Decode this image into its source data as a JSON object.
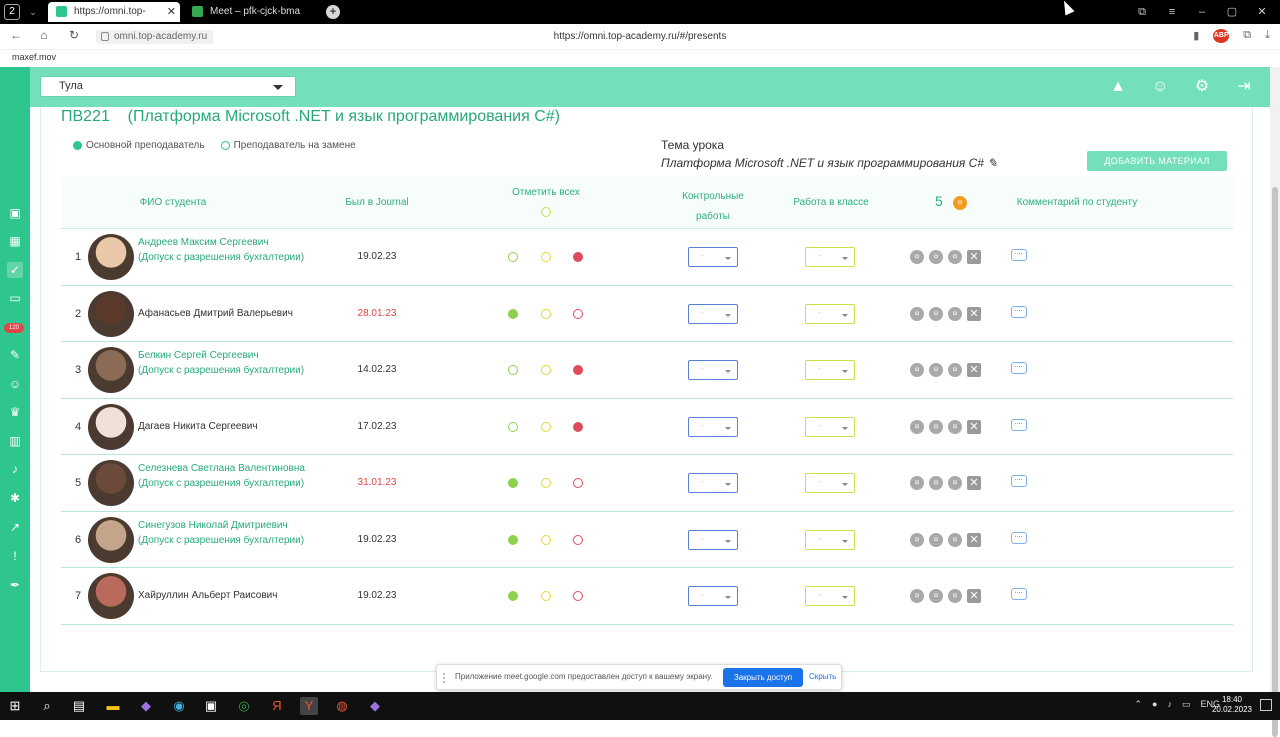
{
  "browser": {
    "window_count": "2",
    "tabs": [
      {
        "title": "https://omni.top-academ",
        "active": true
      },
      {
        "title": "Meet – pfk-cjck-bma",
        "active": false
      }
    ],
    "new_tab": "+",
    "host_chip": "omni.top-academy.ru",
    "url": "https://omni.top-academy.ru/#/presents",
    "bookmark": "maxef.mov",
    "abp": "ABP"
  },
  "app": {
    "city": "Тула",
    "group_title": "ПВ221    (Платформа Microsoft .NET и язык программирования С#)",
    "legend": {
      "main_teacher": "Основной преподаватель",
      "substitute": "Преподаватель на замене"
    },
    "topic_label": "Тема урока",
    "topic_value": "Платформа Microsoft .NET и язык программирования С#",
    "add_material": "ДОБАВИТЬ МАТЕРИАЛ",
    "headers": {
      "student": "ФИО студента",
      "journal": "Был в Journal",
      "mark_all": "Отметить всех",
      "tests": "Контрольные работы",
      "classwork": "Работа в классе",
      "score": "5",
      "comment": "Комментарий по студенту"
    },
    "students": [
      {
        "num": "1",
        "name": "Андреев Максим Сергеевич",
        "note": "(Допуск с разрешения бухгалтерии)",
        "date": "19.02.23",
        "late": false,
        "att": "red"
      },
      {
        "num": "2",
        "name": "Афанасьев Дмитрий Валерьевич",
        "note": "",
        "date": "28.01.23",
        "late": true,
        "att": "green"
      },
      {
        "num": "3",
        "name": "Белкин Сергей Сергеевич",
        "note": "(Допуск с разрешения бухгалтерии)",
        "date": "14.02.23",
        "late": false,
        "att": "red"
      },
      {
        "num": "4",
        "name": "Дагаев Никита Сергеевич",
        "note": "",
        "date": "17.02.23",
        "late": false,
        "att": "red"
      },
      {
        "num": "5",
        "name": "Селезнева Светлана Валентиновна",
        "note": "(Допуск с разрешения бухгалтерии)",
        "date": "31.01.23",
        "late": true,
        "att": "green"
      },
      {
        "num": "6",
        "name": "Синегузов Николай Дмитриевич",
        "note": "(Допуск с разрешения бухгалтерии)",
        "date": "19.02.23",
        "late": false,
        "att": "green"
      },
      {
        "num": "7",
        "name": "Хайруллин Альберт Раисович",
        "note": "",
        "date": "19.02.23",
        "late": false,
        "att": "green"
      }
    ],
    "select_placeholder": "-",
    "colors": {
      "accent": "#2fc58e",
      "header": "#73e0bb",
      "late": "#e04545",
      "orange": "#f59c1e"
    }
  },
  "share_bar": {
    "message": "Приложение meet.google.com предоставлен доступ к вашему экрану.",
    "stop": "Закрыть доступ",
    "hide": "Скрыть"
  },
  "taskbar": {
    "lang": "ENG",
    "time": "18:40",
    "date": "20.02.2023"
  }
}
